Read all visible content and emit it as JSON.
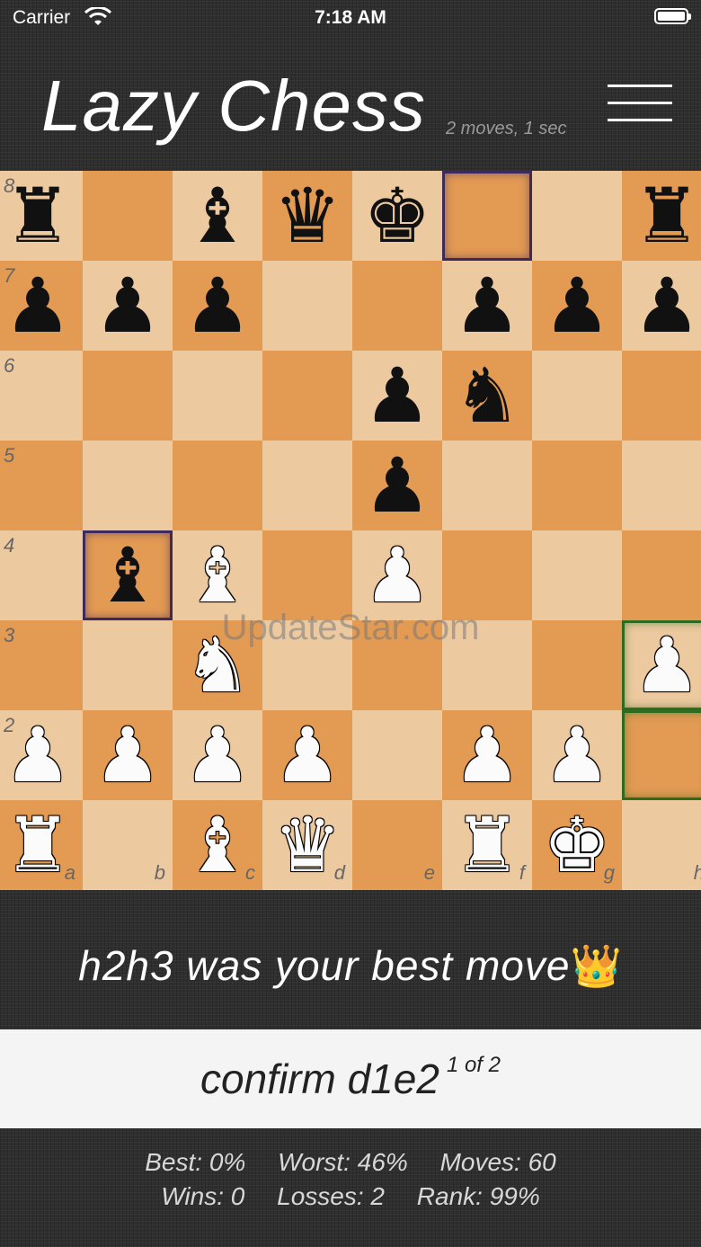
{
  "status_bar": {
    "carrier": "Carrier",
    "time": "7:18 AM"
  },
  "header": {
    "title": "Lazy Chess",
    "subtitle": "2 moves, 1 sec",
    "menu_icon": "hamburger-menu-icon"
  },
  "board": {
    "light_color": "#edc9a0",
    "dark_color": "#e39a53",
    "highlight_last_move_color": "#3d2a5c",
    "highlight_hint_color": "#2e6b1f",
    "rank_labels": [
      "8",
      "7",
      "6",
      "5",
      "4",
      "3",
      "2"
    ],
    "file_labels": [
      "a",
      "b",
      "c",
      "d",
      "e",
      "f",
      "g",
      "h"
    ],
    "ranks": [
      [
        "r",
        "",
        "b",
        "q",
        "k",
        "",
        "",
        "r"
      ],
      [
        "p",
        "p",
        "p",
        "",
        "",
        "p",
        "p",
        "p"
      ],
      [
        "",
        "",
        "",
        "",
        "p",
        "n",
        "",
        ""
      ],
      [
        "",
        "",
        "",
        "",
        "p",
        "",
        "",
        ""
      ],
      [
        "",
        "b",
        "B",
        "",
        "P",
        "",
        "",
        ""
      ],
      [
        "",
        "",
        "N",
        "",
        "",
        "",
        "",
        "P"
      ],
      [
        "P",
        "P",
        "P",
        "P",
        "",
        "P",
        "P",
        ""
      ],
      [
        "R",
        "",
        "B",
        "Q",
        "",
        "R",
        "K",
        ""
      ]
    ],
    "highlights_purple": [
      "f8",
      "b4"
    ],
    "highlights_green": [
      "h3",
      "h2"
    ]
  },
  "watermark": "UpdateStar.com",
  "message": {
    "move": "h2h3",
    "text1": "was your",
    "text2": "best",
    "text3": "move",
    "emoji": "👑"
  },
  "confirm": {
    "label": "confirm",
    "move": "d1e2",
    "counter": "1 of 2"
  },
  "stats": {
    "best_label": "Best:",
    "best_value": "0%",
    "worst_label": "Worst:",
    "worst_value": "46%",
    "moves_label": "Moves:",
    "moves_value": "60",
    "wins_label": "Wins:",
    "wins_value": "0",
    "losses_label": "Losses:",
    "losses_value": "2",
    "rank_label": "Rank:",
    "rank_value": "99%"
  }
}
